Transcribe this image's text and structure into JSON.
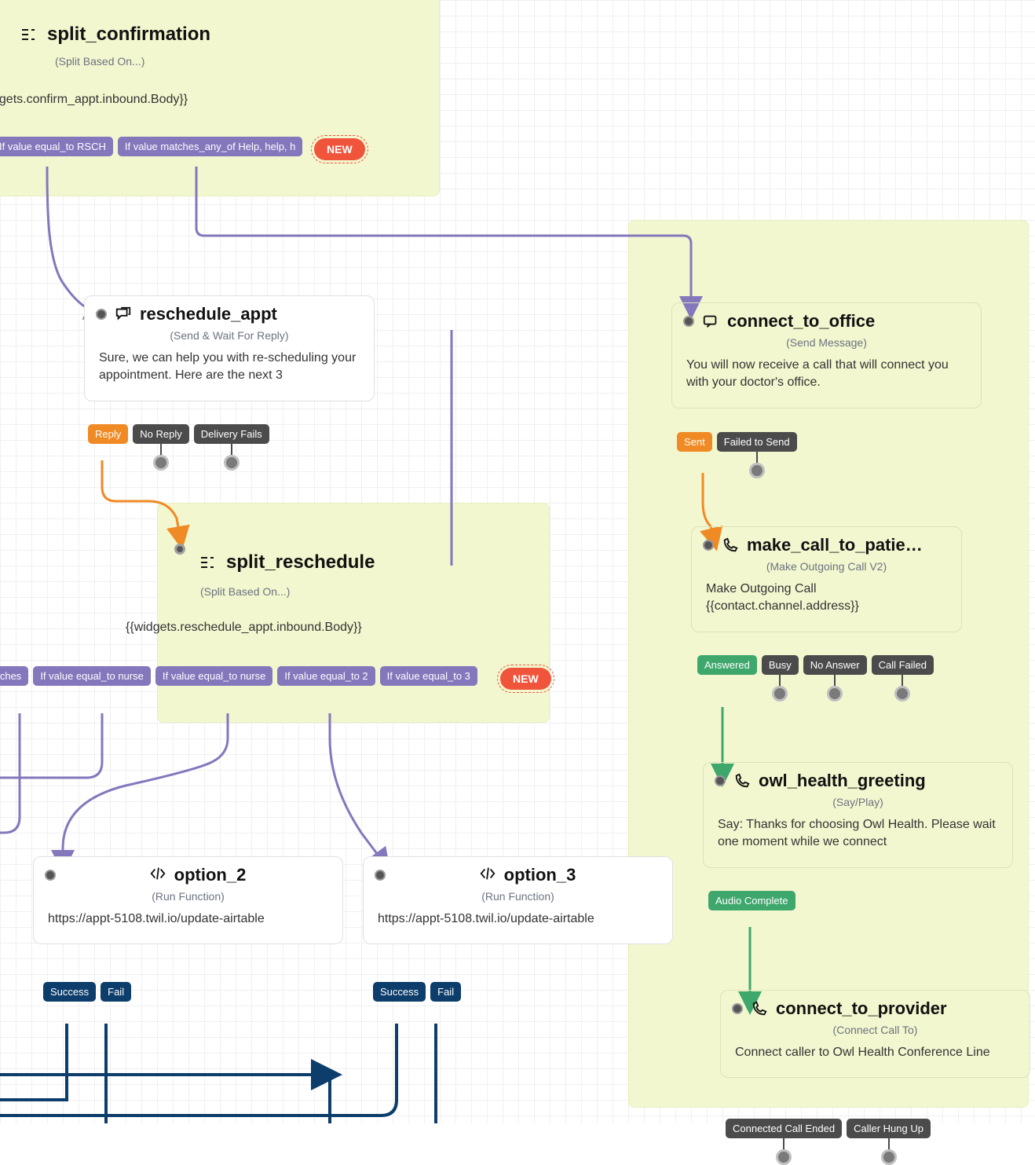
{
  "split_confirmation": {
    "title": "split_confirmation",
    "sub": "(Split Based On...)",
    "expr": "dgets.confirm_appt.inbound.Body}}",
    "cond1": "If value equal_to RSCH",
    "cond2": "If value matches_any_of Help, help, h",
    "new": "NEW"
  },
  "reschedule_appt": {
    "title": "reschedule_appt",
    "sub": "(Send & Wait For Reply)",
    "body": "Sure, we can help you with re-scheduling your appointment. Here are the next 3",
    "p_reply": "Reply",
    "p_noreply": "No Reply",
    "p_delfail": "Delivery Fails"
  },
  "split_reschedule": {
    "title": "split_reschedule",
    "sub": "(Split Based On...)",
    "expr": "{{widgets.reschedule_appt.inbound.Body}}",
    "c0": "atches",
    "c1": "If value equal_to nurse",
    "c2": "If value equal_to nurse",
    "c3": "If value equal_to 2",
    "c4": "If value equal_to 3",
    "new": "NEW"
  },
  "option_2": {
    "title": "option_2",
    "sub": "(Run Function)",
    "body": "https://appt-5108.twil.io/update-airtable",
    "p_success": "Success",
    "p_fail": "Fail"
  },
  "option_3": {
    "title": "option_3",
    "sub": "(Run Function)",
    "body": "https://appt-5108.twil.io/update-airtable",
    "p_success": "Success",
    "p_fail": "Fail"
  },
  "connect_to_office": {
    "title": "connect_to_office",
    "sub": "(Send Message)",
    "body": "You will now receive a call that will connect you with your doctor's office.",
    "p_sent": "Sent",
    "p_failed": "Failed to Send"
  },
  "make_call": {
    "title": "make_call_to_patie…",
    "sub": "(Make Outgoing Call V2)",
    "body": "Make Outgoing Call {{contact.channel.address}}",
    "p_answered": "Answered",
    "p_busy": "Busy",
    "p_noanswer": "No Answer",
    "p_callfailed": "Call Failed"
  },
  "owl_health": {
    "title": "owl_health_greeting",
    "sub": "(Say/Play)",
    "body": "Say: Thanks for choosing Owl Health. Please wait one moment while we connect",
    "p_audio": "Audio Complete"
  },
  "connect_to_provider": {
    "title": "connect_to_provider",
    "sub": "(Connect Call To)",
    "body": "Connect caller to Owl Health Conference Line",
    "p_ended": "Connected Call Ended",
    "p_hung": "Caller Hung Up"
  }
}
